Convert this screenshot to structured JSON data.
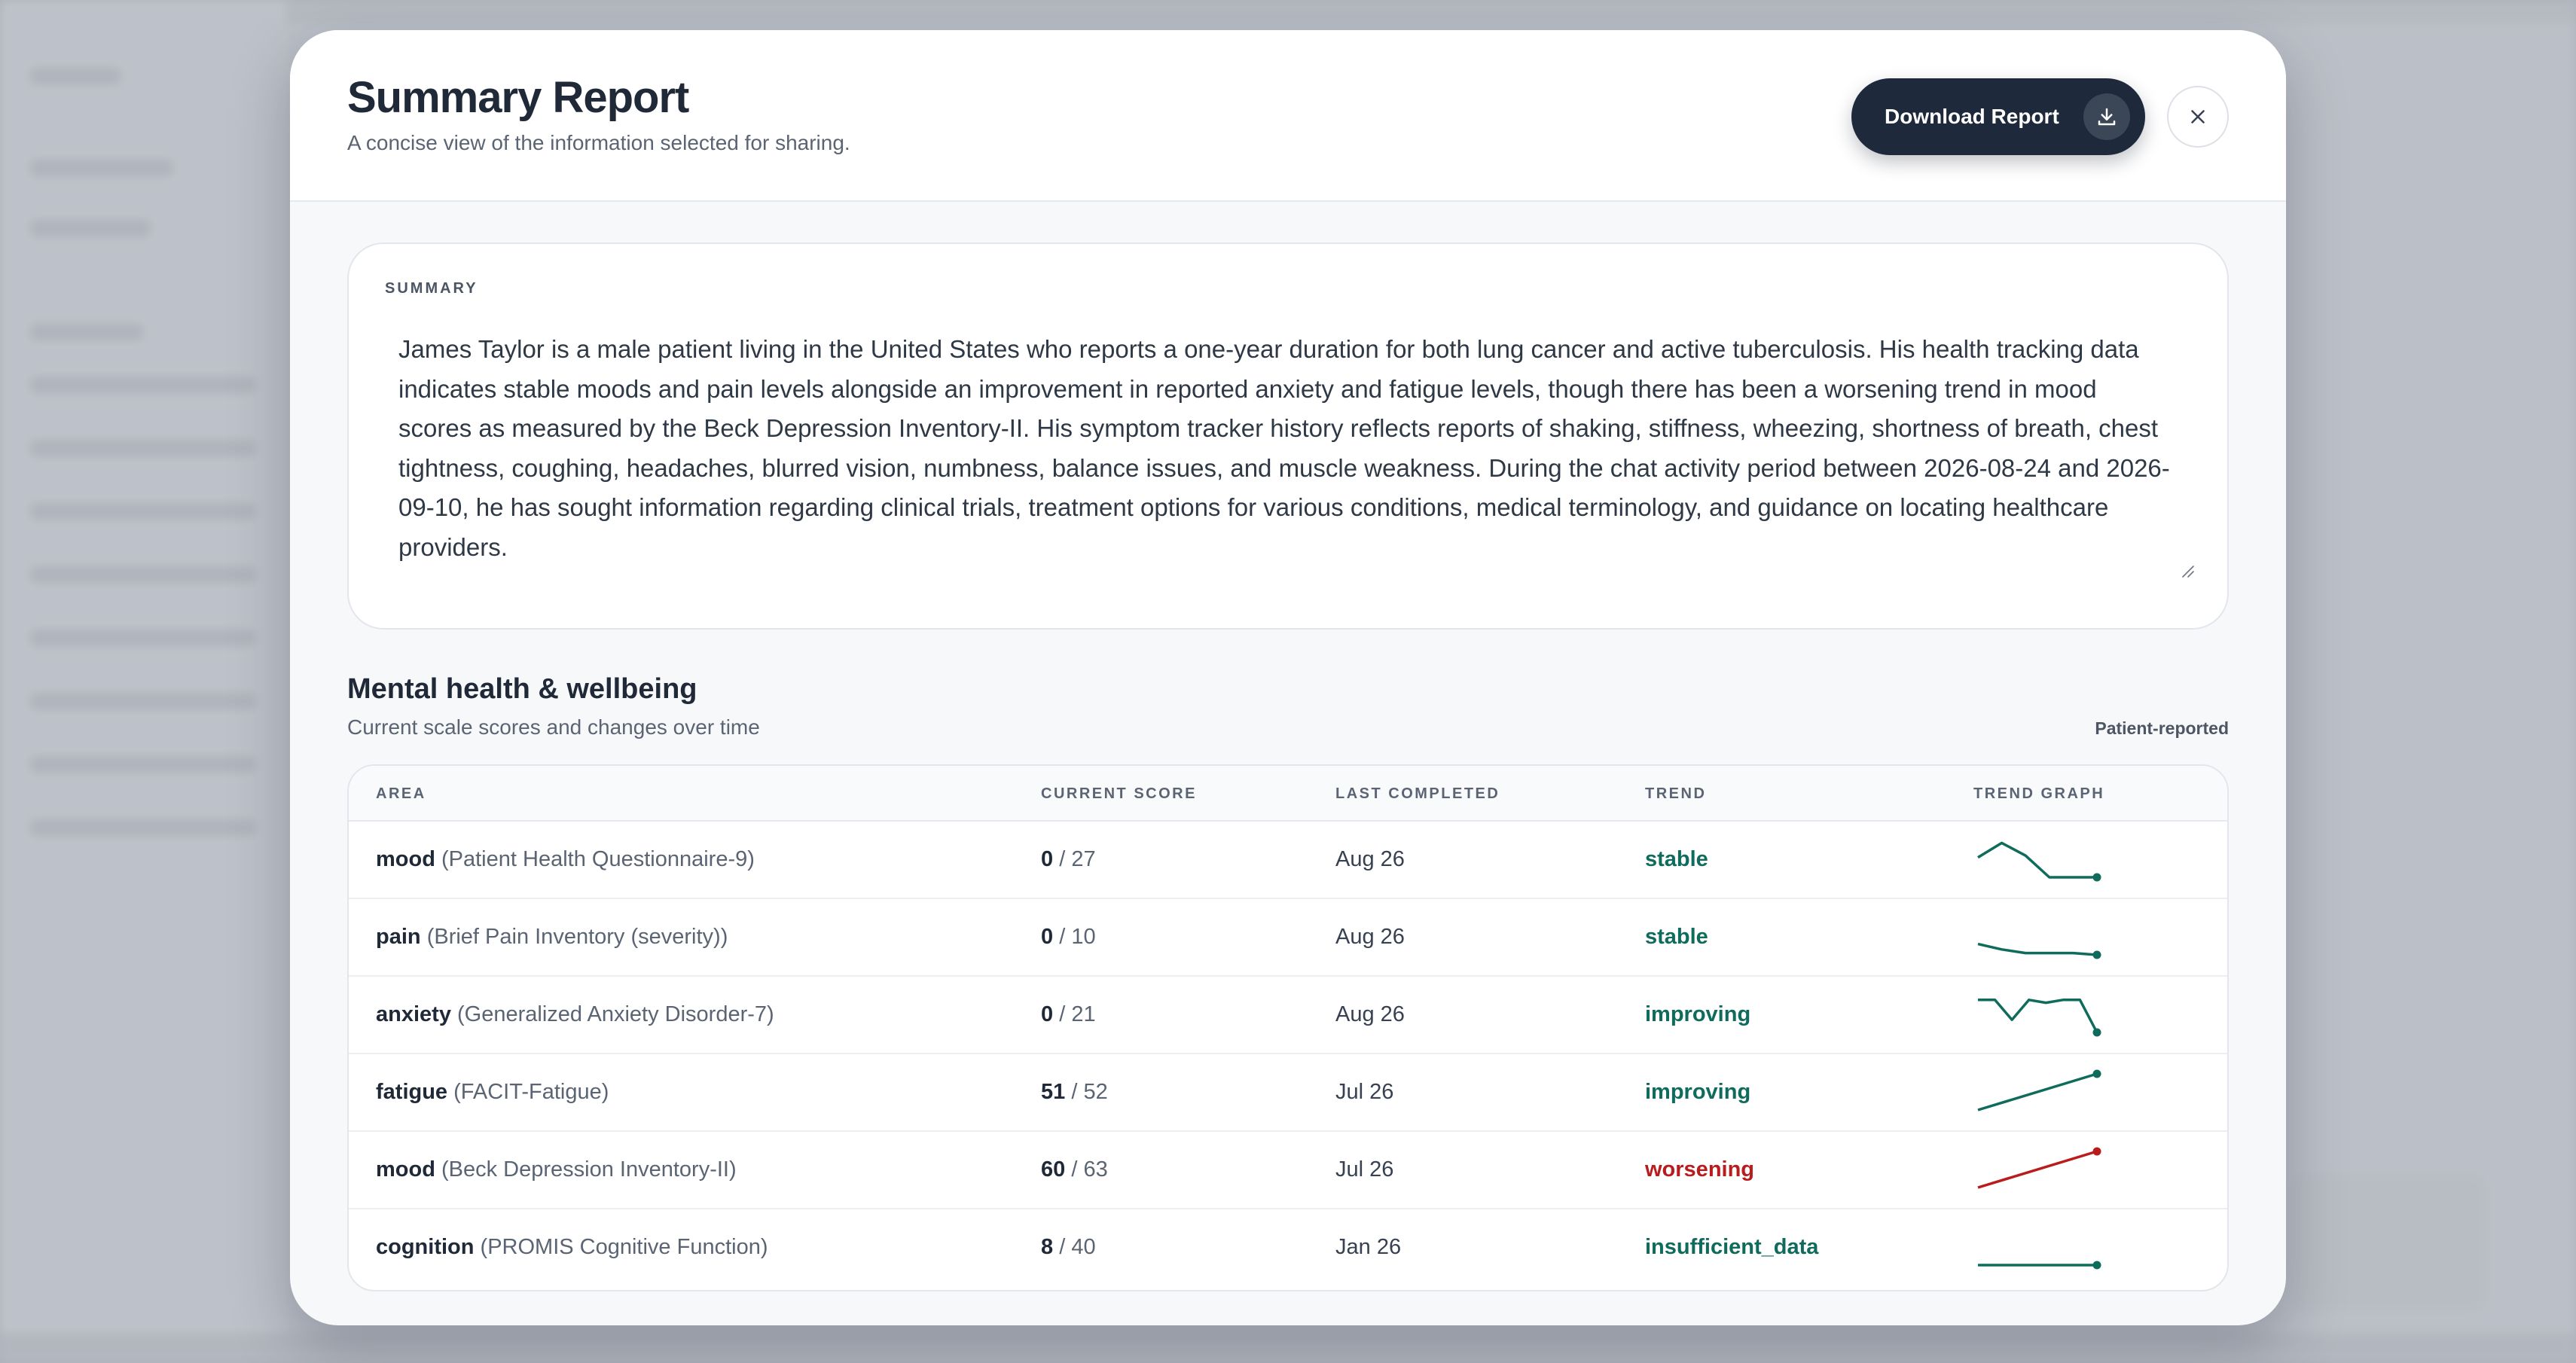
{
  "modal": {
    "title": "Summary Report",
    "subtitle": "A concise view of the information selected for sharing.",
    "download_label": "Download Report"
  },
  "summary": {
    "label": "SUMMARY",
    "text": "James Taylor is a male patient living in the United States who reports a one-year duration for both lung cancer and active tuberculosis. His health tracking data indicates stable moods and pain levels alongside an improvement in reported anxiety and fatigue levels, though there has been a worsening trend in mood scores as measured by the Beck Depression Inventory-II. His symptom tracker history reflects reports of shaking, stiffness, wheezing, shortness of breath, chest tightness, coughing, headaches, blurred vision, numbness, balance issues, and muscle weakness. During the chat activity period between 2026-08-24 and 2026-09-10, he has sought information regarding clinical trials, treatment options for various conditions, medical terminology, and guidance on locating healthcare providers."
  },
  "section": {
    "title": "Mental health & wellbeing",
    "subtitle": "Current scale scores and changes over time",
    "tag": "Patient-reported"
  },
  "table": {
    "headers": {
      "area": "AREA",
      "score": "CURRENT SCORE",
      "last": "LAST COMPLETED",
      "trend": "TREND",
      "graph": "TREND GRAPH"
    },
    "rows": [
      {
        "area": "mood",
        "scale": "(Patient Health Questionnaire-9)",
        "score": "0",
        "max": "/ 27",
        "last": "Aug 26",
        "trend": "stable",
        "trend_color": "#0f6b5c",
        "spark": [
          0.55,
          0.95,
          0.6,
          0.0,
          0.0,
          0.0
        ]
      },
      {
        "area": "pain",
        "scale": "(Brief Pain Inventory (severity))",
        "score": "0",
        "max": "/ 10",
        "last": "Aug 26",
        "trend": "stable",
        "trend_color": "#0f6b5c",
        "spark": [
          0.3,
          0.15,
          0.05,
          0.05,
          0.05,
          0.0
        ]
      },
      {
        "area": "anxiety",
        "scale": "(Generalized Anxiety Disorder-7)",
        "score": "0",
        "max": "/ 21",
        "last": "Aug 26",
        "trend": "improving",
        "trend_color": "#0f6b5c",
        "spark": [
          0.9,
          0.9,
          0.35,
          0.9,
          0.82,
          0.9,
          0.9,
          0.0
        ]
      },
      {
        "area": "fatigue",
        "scale": "(FACIT-Fatigue)",
        "score": "51",
        "max": "/ 52",
        "last": "Jul 26",
        "trend": "improving",
        "trend_color": "#0f6b5c",
        "spark": [
          0.0,
          1.0
        ]
      },
      {
        "area": "mood",
        "scale": "(Beck Depression Inventory-II)",
        "score": "60",
        "max": "/ 63",
        "last": "Jul 26",
        "trend": "worsening",
        "trend_color": "#b91c1c",
        "spark": [
          0.0,
          1.0
        ]
      },
      {
        "area": "cognition",
        "scale": "(PROMIS Cognitive Function)",
        "score": "8",
        "max": "/ 40",
        "last": "Jan 26",
        "trend": "insufficient_data",
        "trend_color": "#0f6b5c",
        "spark": [
          0.0,
          0.0
        ]
      }
    ]
  }
}
